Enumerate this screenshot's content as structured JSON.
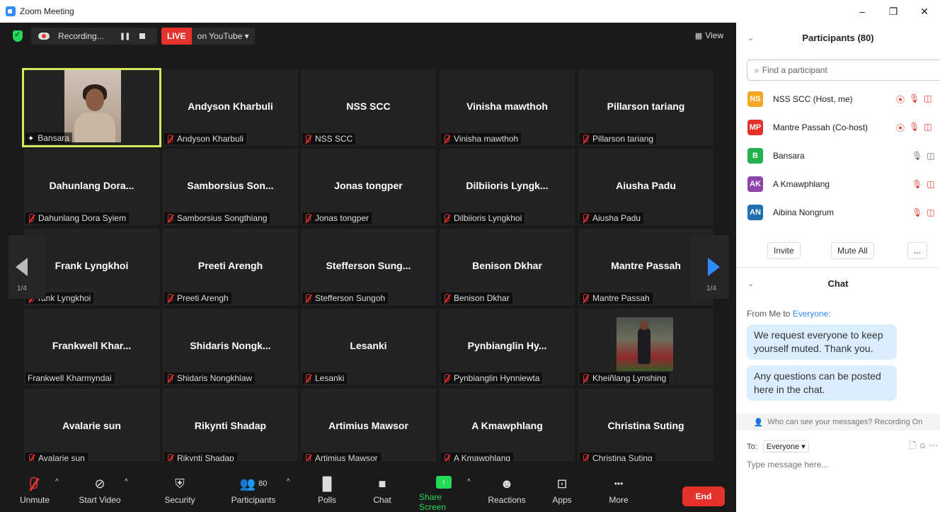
{
  "window": {
    "title": "Zoom Meeting",
    "minimize": "–",
    "restore": "❐",
    "close": "✕"
  },
  "topbar": {
    "recording": "Recording...",
    "pause_icon": "❚❚",
    "live": "LIVE",
    "live_dest": "on YouTube ▾",
    "view": "View",
    "view_icon": "grid-icon"
  },
  "nav": {
    "left_page": "1/4",
    "right_page": "1/4"
  },
  "tiles": [
    {
      "name": "",
      "label": "Bansara",
      "muted": false,
      "pinned": true,
      "video": "person",
      "active": true
    },
    {
      "name": "Andyson Kharbuli",
      "label": "Andyson Kharbuli",
      "muted": true
    },
    {
      "name": "NSS SCC",
      "label": "NSS SCC",
      "muted": true
    },
    {
      "name": "Vinisha mawthoh",
      "label": "Vinisha mawthoh",
      "muted": true
    },
    {
      "name": "Pillarson tariang",
      "label": "Pillarson tariang",
      "muted": true
    },
    {
      "name": "Dahunlang  Dora...",
      "label": "Dahunlang Dora Syiem",
      "muted": true
    },
    {
      "name": "Samborsius  Son...",
      "label": "Samborsius Songthiang",
      "muted": true
    },
    {
      "name": "Jonas tongper",
      "label": "Jonas tongper",
      "muted": true
    },
    {
      "name": "Dilbiioris  Lyngk...",
      "label": "Dilbiioris Lyngkhoi",
      "muted": true
    },
    {
      "name": "Aiusha Padu",
      "label": "Aiusha Padu",
      "muted": true
    },
    {
      "name": "Frank Lyngkhoi",
      "label": "rank Lyngkhoi",
      "muted": true
    },
    {
      "name": "Preeti Arengh",
      "label": "Preeti Arengh",
      "muted": true
    },
    {
      "name": "Stefferson  Sung...",
      "label": "Stefferson Sungoh",
      "muted": true
    },
    {
      "name": "Benison Dkhar",
      "label": "Benison Dkhar",
      "muted": true
    },
    {
      "name": "Mantre Passah",
      "label": "Mantre Passah",
      "muted": true
    },
    {
      "name": "Frankwell  Khar...",
      "label": "Frankwell Kharmyndai",
      "muted": false
    },
    {
      "name": "Shidaris  Nongk...",
      "label": "Shidaris Nongkhlaw",
      "muted": true
    },
    {
      "name": "Lesanki",
      "label": "Lesanki",
      "muted": true
    },
    {
      "name": "Pynbianglin  Hy...",
      "label": "Pynbianglin Hynniewta",
      "muted": true
    },
    {
      "name": "",
      "label": "Kheiñlang Lynshing",
      "muted": true,
      "video": "avatar"
    },
    {
      "name": "Avalarie sun",
      "label": "Avalarie sun",
      "muted": true
    },
    {
      "name": "Rikynti Shadap",
      "label": "Rikynti Shadap",
      "muted": true
    },
    {
      "name": "Artimius Mawsor",
      "label": "Artimius Mawsor",
      "muted": true
    },
    {
      "name": "A Kmawphlang",
      "label": "A Kmawphlang",
      "muted": true
    },
    {
      "name": "Christina Suting",
      "label": "Christina Suting",
      "muted": true
    }
  ],
  "toolbar": {
    "unmute": "Unmute",
    "start_video": "Start Video",
    "security": "Security",
    "participants": "Participants",
    "participants_count": "80",
    "polls": "Polls",
    "chat": "Chat",
    "share_screen": "Share Screen",
    "reactions": "Reactions",
    "apps": "Apps",
    "more": "More",
    "end": "End",
    "caret": "^",
    "more_icon": "•••",
    "share_arrow": "↑"
  },
  "panel": {
    "participants_title": "Participants (80)",
    "search_placeholder": "Find a participant",
    "participants": [
      {
        "initials": "NS",
        "color": "#f5a623",
        "name": "NSS SCC (Host, me)"
      },
      {
        "initials": "MP",
        "color": "#e5322d",
        "name": "Mantre Passah (Co-host)"
      },
      {
        "initials": "B",
        "color": "#23b14d",
        "name": "Bansara"
      },
      {
        "initials": "AK",
        "color": "#8e44ad",
        "name": "A Kmawphlang"
      },
      {
        "initials": "AN",
        "color": "#1f6fb2",
        "name": "Aibina Nongrum"
      }
    ],
    "invite": "Invite",
    "mute_all": "Mute All",
    "more": "...",
    "chat_title": "Chat",
    "from": "From Me to ",
    "from_to": "Everyone:",
    "messages": [
      "We request everyone to keep yourself muted. Thank you.",
      "Any questions can be posted here in the chat."
    ],
    "who_can_see": "Who can see your messages? Recording On",
    "to_label": "To:",
    "to_value": "Everyone ▾",
    "type_placeholder": "Type message here..."
  }
}
